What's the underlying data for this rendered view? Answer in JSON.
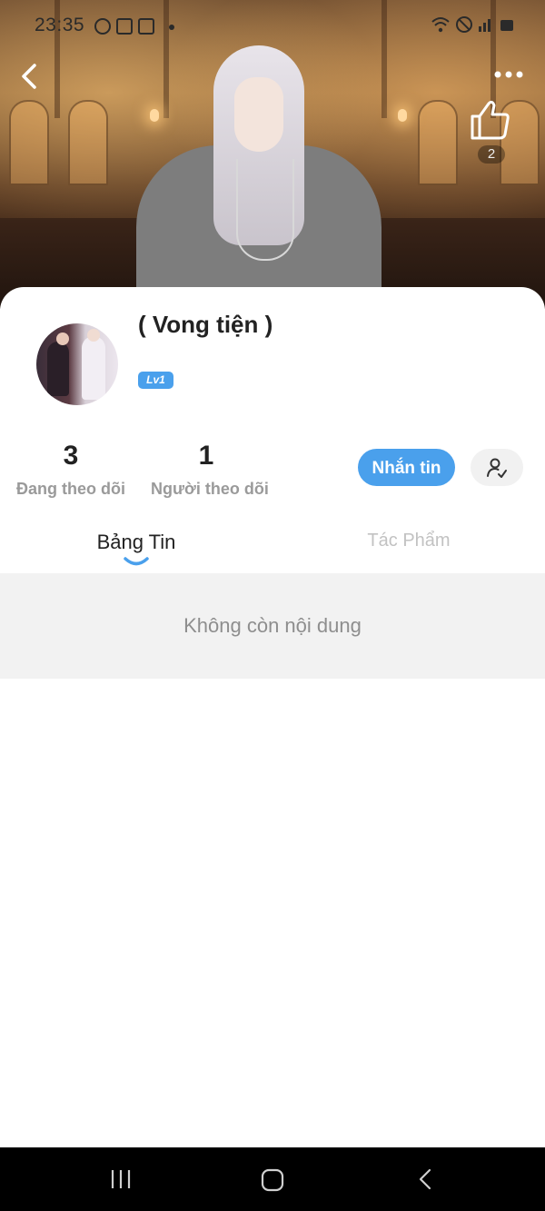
{
  "status_bar": {
    "time": "23:35"
  },
  "header": {
    "like_count": "2"
  },
  "profile": {
    "name": "( Vong tiện )",
    "level": "Lv1",
    "stats": [
      {
        "value": "3",
        "label": "Đang theo dõi"
      },
      {
        "value": "1",
        "label": "Người theo dõi"
      }
    ],
    "message_button": "Nhắn tin"
  },
  "tabs": [
    {
      "label": "Bảng Tin",
      "active": true
    },
    {
      "label": "Tác Phẩm",
      "active": false
    }
  ],
  "feed": {
    "empty_text": "Không còn nội dung"
  },
  "colors": {
    "accent": "#4aa0ec",
    "nav_bar": "#000000"
  },
  "icons": [
    "back-icon",
    "more-icon",
    "thumbs-up-icon",
    "follow-user-icon",
    "recents-icon",
    "home-icon",
    "nav-back-icon"
  ]
}
